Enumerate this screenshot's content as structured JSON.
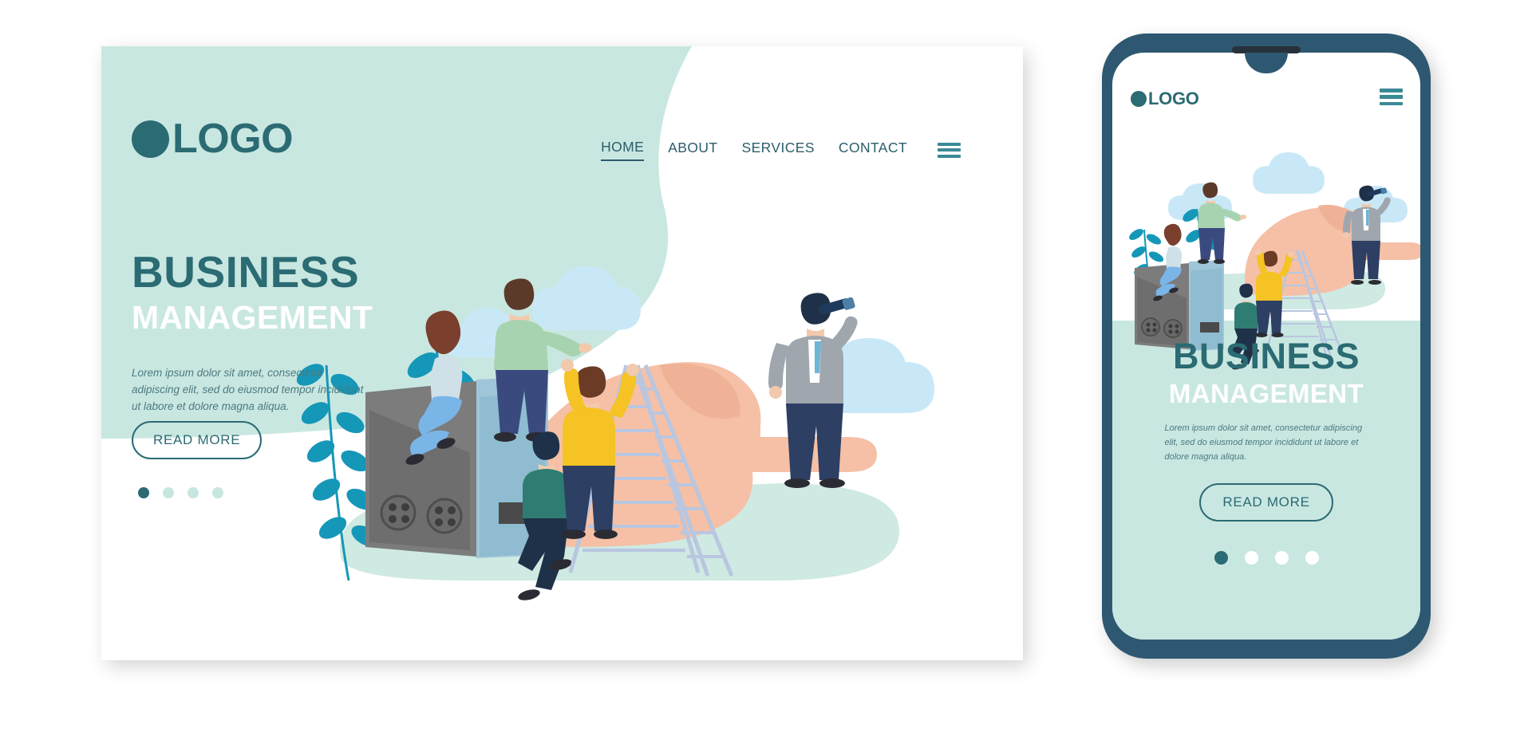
{
  "page": {
    "background_color": "#ffffff"
  },
  "theme": {
    "mint_bg": "#c9e7e1",
    "deep_teal": "#2b6b73",
    "nav_teal": "#2b5d6b",
    "accent_teal": "#3a8a95",
    "leaf_teal": "#1597b8",
    "skin_peach": "#f5c0a6",
    "phone_bezel": "#2e5871",
    "white": "#ffffff",
    "dot_inactive": "#c7e6e0",
    "box_gray": "#7a7a7a",
    "box_blue": "#8fc0d4",
    "yellow_shirt": "#f5c324",
    "cloud_blue": "#c9e8f7"
  },
  "desktop": {
    "logo": {
      "icon": "circle-dot-icon",
      "text": "LOGO"
    },
    "nav": {
      "items": [
        {
          "label": "HOME",
          "active": true
        },
        {
          "label": "ABOUT",
          "active": false
        },
        {
          "label": "SERVICES",
          "active": false
        },
        {
          "label": "CONTACT",
          "active": false
        }
      ],
      "menu_icon": "hamburger-menu-icon"
    },
    "hero": {
      "headline_top": "BUSINESS",
      "headline_bottom": "MANAGEMENT",
      "paragraph": "Lorem ipsum dolor sit amet, consectetur adipiscing elit, sed do eiusmod tempor incididunt ut labore et dolore magna aliqua.",
      "cta_label": "READ MORE"
    },
    "carousel": {
      "total": 4,
      "active_index": 0,
      "dots": [
        {
          "active": true
        },
        {
          "active": false
        },
        {
          "active": false
        },
        {
          "active": false
        }
      ]
    }
  },
  "phone": {
    "logo": {
      "icon": "circle-dot-icon",
      "text": "LOGO"
    },
    "menu_icon": "hamburger-menu-icon",
    "hero": {
      "headline_top": "BUSINESS",
      "headline_bottom": "MANAGEMENT",
      "paragraph": "Lorem ipsum dolor sit amet, consectetur adipiscing elit, sed do eiusmod tempor incididunt ut labore et dolore magna aliqua.",
      "cta_label": "READ MORE"
    },
    "carousel": {
      "total": 4,
      "active_index": 0,
      "dots": [
        {
          "active": true
        },
        {
          "active": false
        },
        {
          "active": false
        },
        {
          "active": false
        }
      ]
    }
  },
  "illustration": {
    "description": "Flat vector business teamwork scene",
    "elements": [
      "giant-pointing-hand",
      "step-ladder",
      "gray-equipment-box",
      "blue-panel",
      "leaf-branch-plant",
      "clouds",
      "mint-ground-shape"
    ],
    "characters": [
      {
        "name": "woman-sitting-on-box",
        "hair": "auburn",
        "clothing": "light-blue"
      },
      {
        "name": "man-pointing-on-panel",
        "clothing": "green-shirt-navy-pants"
      },
      {
        "name": "man-walking",
        "clothing": "teal-shirt-navy-pants"
      },
      {
        "name": "man-climbing-ladder",
        "clothing": "yellow-shirt-navy-pants"
      },
      {
        "name": "businessman-with-telescope",
        "clothing": "gray-jacket-navy-pants"
      }
    ]
  }
}
